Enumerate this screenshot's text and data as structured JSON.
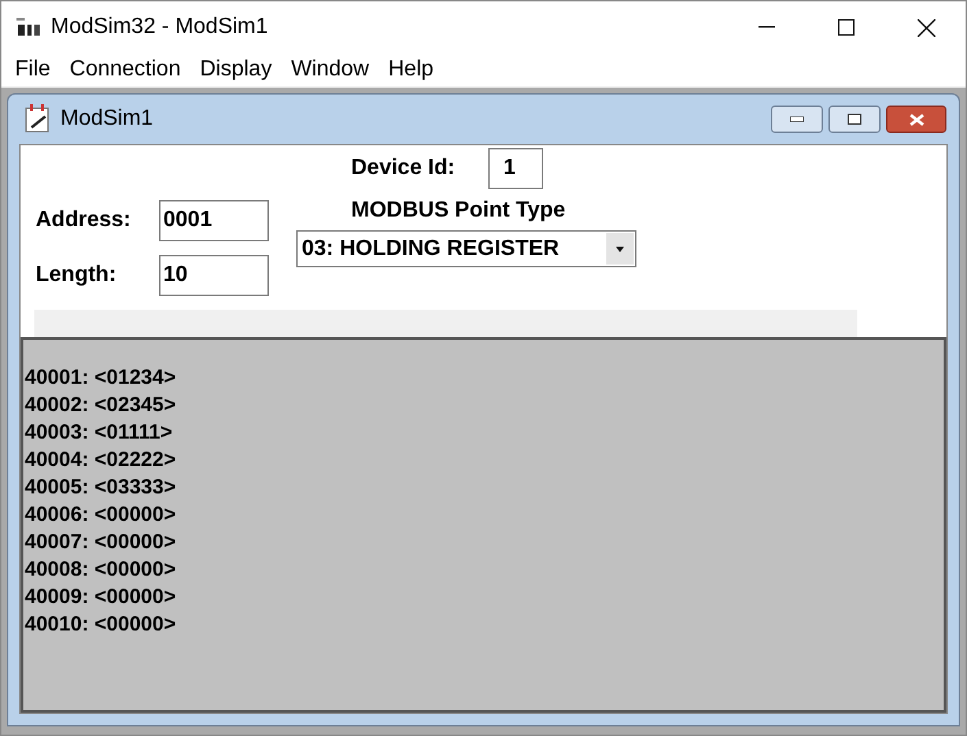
{
  "window": {
    "title": "ModSim32 - ModSim1"
  },
  "menu": [
    "File",
    "Connection",
    "Display",
    "Window",
    "Help"
  ],
  "child_window": {
    "title": "ModSim1"
  },
  "form": {
    "device_id_label": "Device Id:",
    "device_id": "1",
    "address_label": "Address:",
    "address": "0001",
    "length_label": "Length:",
    "length": "10",
    "point_type_label": "MODBUS Point Type",
    "point_type": "03: HOLDING REGISTER"
  },
  "registers": [
    "40001: <01234>",
    "40002: <02345>",
    "40003: <01111>",
    "40004: <02222>",
    "40005: <03333>",
    "40006: <00000>",
    "40007: <00000>",
    "40008: <00000>",
    "40009: <00000>",
    "40010: <00000>"
  ]
}
